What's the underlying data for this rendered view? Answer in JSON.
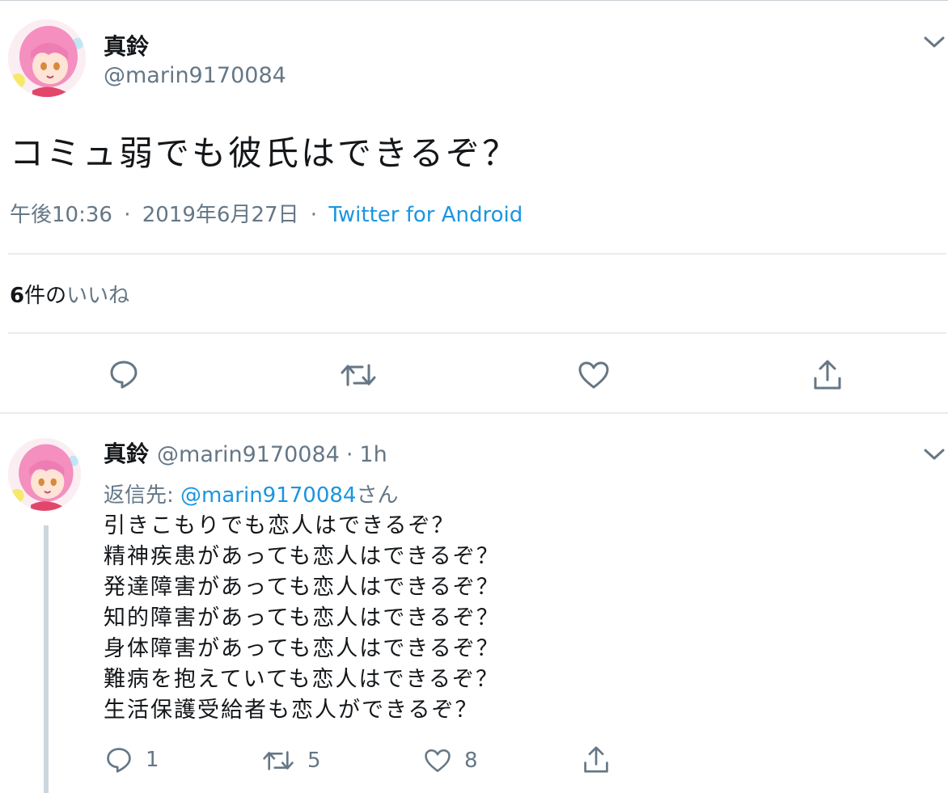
{
  "main_tweet": {
    "display_name": "真鈴",
    "handle": "@marin9170084",
    "text": "コミュ弱でも彼氏はできるぞ？",
    "time": "午後10:36",
    "date": "2019年6月27日",
    "separator": "·",
    "source": "Twitter for Android",
    "likes_count": "6",
    "likes_suffix": "件の",
    "likes_label": "いいね"
  },
  "reply_tweet": {
    "display_name": "真鈴",
    "handle": "@marin9170084",
    "separator": "·",
    "time_ago": "1h",
    "replying_to_prefix": "返信先: ",
    "replying_to_mention": "@marin9170084",
    "replying_to_suffix": "さん",
    "lines": [
      "引きこもりでも恋人はできるぞ？",
      "精神疾患があっても恋人はできるぞ？",
      "発達障害があっても恋人はできるぞ？",
      "知的障害があっても恋人はできるぞ？",
      "身体障害があっても恋人はできるぞ？",
      "難病を抱えていても恋人はできるぞ？",
      "生活保護受給者も恋人ができるぞ？"
    ],
    "reply_count": "1",
    "retweet_count": "5",
    "like_count": "8"
  },
  "icons": {
    "reply": "reply-icon",
    "retweet": "retweet-icon",
    "like": "heart-icon",
    "share": "share-icon",
    "menu": "chevron-down-icon"
  },
  "colors": {
    "accent": "#1b95e0",
    "muted": "#657786",
    "text": "#14171a",
    "divider": "#e6ecf0",
    "thread_line": "#ccd6dd"
  }
}
